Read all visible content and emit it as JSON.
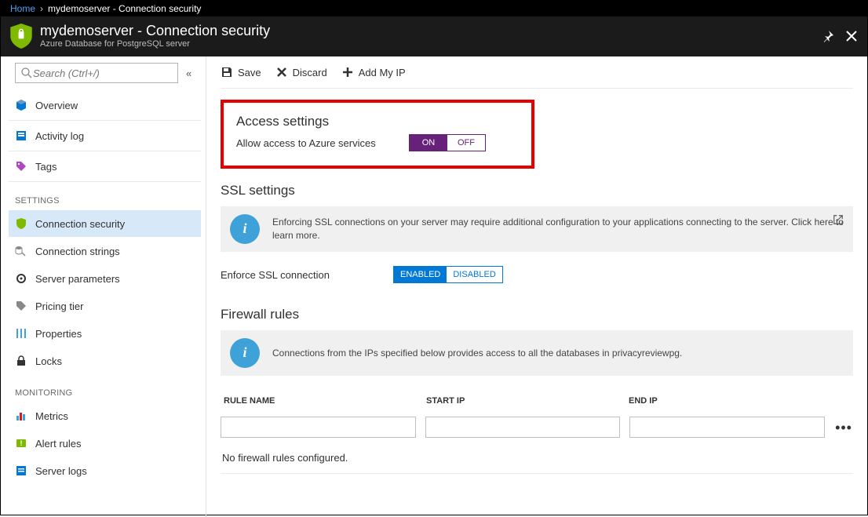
{
  "breadcrumb": {
    "home": "Home",
    "current": "mydemoserver - Connection security"
  },
  "header": {
    "title": "mydemoserver - Connection security",
    "subtitle": "Azure Database for PostgreSQL server"
  },
  "search": {
    "placeholder": "Search (Ctrl+/)"
  },
  "sidebar": {
    "top": [
      {
        "label": "Overview"
      },
      {
        "label": "Activity log"
      },
      {
        "label": "Tags"
      }
    ],
    "settings_header": "SETTINGS",
    "settings": [
      {
        "label": "Connection security",
        "selected": true
      },
      {
        "label": "Connection strings"
      },
      {
        "label": "Server parameters"
      },
      {
        "label": "Pricing tier"
      },
      {
        "label": "Properties"
      },
      {
        "label": "Locks"
      }
    ],
    "monitoring_header": "MONITORING",
    "monitoring": [
      {
        "label": "Metrics"
      },
      {
        "label": "Alert rules"
      },
      {
        "label": "Server logs"
      }
    ]
  },
  "toolbar": {
    "save": "Save",
    "discard": "Discard",
    "addIp": "Add My IP"
  },
  "access": {
    "title": "Access settings",
    "label": "Allow access to Azure services",
    "on": "ON",
    "off": "OFF"
  },
  "ssl": {
    "title": "SSL settings",
    "info": "Enforcing SSL connections on your server may require additional configuration to your applications connecting to the server.  Click here to learn more.",
    "label": "Enforce SSL connection",
    "enabled": "ENABLED",
    "disabled": "DISABLED"
  },
  "firewall": {
    "title": "Firewall rules",
    "info": "Connections from the IPs specified below provides access to all the databases in privacyreviewpg.",
    "col_rule": "RULE NAME",
    "col_start": "START IP",
    "col_end": "END IP",
    "empty": "No firewall rules configured."
  }
}
